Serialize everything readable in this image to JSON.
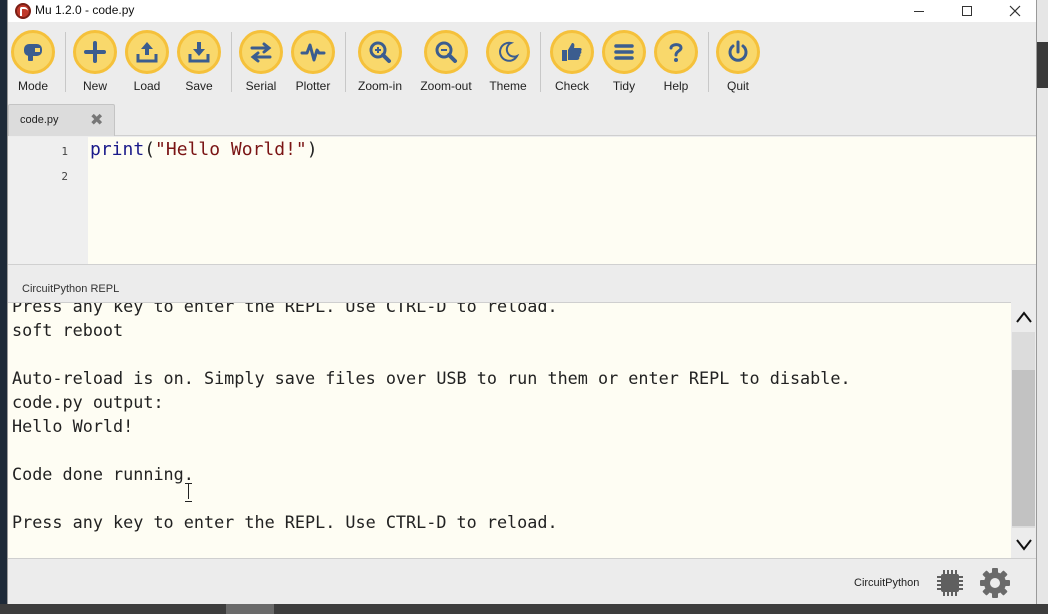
{
  "window": {
    "title": "Mu 1.2.0 - code.py"
  },
  "toolbar": {
    "buttons": [
      {
        "label": "Mode",
        "icon": "mode-icon"
      },
      {
        "label": "New",
        "icon": "plus-icon"
      },
      {
        "label": "Load",
        "icon": "upload-icon"
      },
      {
        "label": "Save",
        "icon": "download-icon"
      },
      {
        "label": "Serial",
        "icon": "swap-arrows-icon"
      },
      {
        "label": "Plotter",
        "icon": "pulse-icon"
      },
      {
        "label": "Zoom-in",
        "icon": "zoom-in-icon"
      },
      {
        "label": "Zoom-out",
        "icon": "zoom-out-icon"
      },
      {
        "label": "Theme",
        "icon": "moon-icon"
      },
      {
        "label": "Check",
        "icon": "thumbs-up-icon"
      },
      {
        "label": "Tidy",
        "icon": "lines-icon"
      },
      {
        "label": "Help",
        "icon": "question-icon"
      },
      {
        "label": "Quit",
        "icon": "power-icon"
      }
    ]
  },
  "tabs": [
    {
      "label": "code.py",
      "close": "✖"
    }
  ],
  "editor": {
    "lines": [
      {
        "number": "1",
        "keyword": "print",
        "open": "(",
        "string": "\"Hello World!\"",
        "close": ")"
      },
      {
        "number": "2"
      }
    ]
  },
  "repl": {
    "label": "CircuitPython REPL",
    "lines": [
      "Press any key to enter the REPL. Use CTRL-D to reload.",
      "soft reboot",
      "",
      "Auto-reload is on. Simply save files over USB to run them or enter REPL to disable.",
      "code.py output:",
      "Hello World!",
      "",
      "Code done running.",
      "",
      "Press any key to enter the REPL. Use CTRL-D to reload."
    ]
  },
  "statusbar": {
    "mode": "CircuitPython"
  },
  "colors": {
    "button_fill": "#f9d86b",
    "button_ring": "#f5c13b",
    "icon": "#3b5d8f",
    "editor_bg": "#fefdf3"
  }
}
